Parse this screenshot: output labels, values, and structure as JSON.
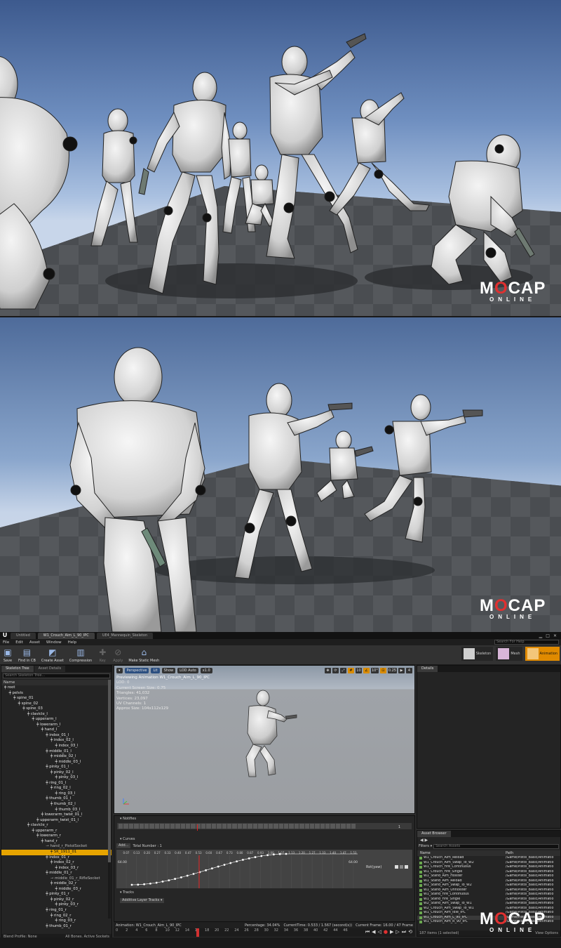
{
  "branding": {
    "mocap_big_pre": "M",
    "mocap_big_o": "O",
    "mocap_big_post": "CAP",
    "mocap_small": "ONLINE"
  },
  "editor": {
    "doc_tabs": [
      "Untitled",
      "W1_Crouch_Aim_L_90_IPC",
      "UE4_Mannequin_Skeleton"
    ],
    "menu": [
      "File",
      "Edit",
      "Asset",
      "Window",
      "Help"
    ],
    "help_search_placeholder": "Search For Help",
    "toolbar": [
      {
        "label": "Save",
        "icon": "save-icon"
      },
      {
        "label": "Find in CB",
        "icon": "find-in-content-browser-icon"
      },
      {
        "label": "Create Asset",
        "icon": "create-asset-icon"
      },
      {
        "label": "Compression",
        "icon": "compression-icon"
      },
      {
        "label": "Key",
        "icon": "key-icon",
        "disabled": true
      },
      {
        "label": "Apply",
        "icon": "apply-icon",
        "disabled": true
      },
      {
        "label": "Make Static Mesh",
        "icon": "make-static-mesh-icon"
      }
    ],
    "modes": [
      {
        "label": "Skeleton"
      },
      {
        "label": "Mesh"
      },
      {
        "label": "Animation",
        "active": true
      }
    ],
    "left_tabs": [
      "Skeleton Tree",
      "Asset Details"
    ],
    "skeleton_search_placeholder": "Search Skeleton Tree...",
    "tree_header": "Name",
    "bones": [
      {
        "name": "root",
        "depth": 0
      },
      {
        "name": "pelvis",
        "depth": 1
      },
      {
        "name": "spine_01",
        "depth": 2
      },
      {
        "name": "spine_02",
        "depth": 3
      },
      {
        "name": "spine_03",
        "depth": 4
      },
      {
        "name": "clavicle_l",
        "depth": 5
      },
      {
        "name": "upperarm_l",
        "depth": 6
      },
      {
        "name": "lowerarm_l",
        "depth": 7
      },
      {
        "name": "hand_l",
        "depth": 8
      },
      {
        "name": "index_01_l",
        "depth": 9
      },
      {
        "name": "index_02_l",
        "depth": 10
      },
      {
        "name": "index_03_l",
        "depth": 11
      },
      {
        "name": "middle_01_l",
        "depth": 9
      },
      {
        "name": "middle_02_l",
        "depth": 10
      },
      {
        "name": "middle_03_l",
        "depth": 11
      },
      {
        "name": "pinky_01_l",
        "depth": 9
      },
      {
        "name": "pinky_02_l",
        "depth": 10
      },
      {
        "name": "pinky_03_l",
        "depth": 11
      },
      {
        "name": "ring_01_l",
        "depth": 9
      },
      {
        "name": "ring_02_l",
        "depth": 10
      },
      {
        "name": "ring_03_l",
        "depth": 11
      },
      {
        "name": "thumb_01_l",
        "depth": 9
      },
      {
        "name": "thumb_02_l",
        "depth": 10
      },
      {
        "name": "thumb_03_l",
        "depth": 11
      },
      {
        "name": "lowerarm_twist_01_l",
        "depth": 8
      },
      {
        "name": "upperarm_twist_01_l",
        "depth": 7
      },
      {
        "name": "clavicle_r",
        "depth": 5
      },
      {
        "name": "upperarm_r",
        "depth": 6
      },
      {
        "name": "lowerarm_r",
        "depth": 7
      },
      {
        "name": "hand_r",
        "depth": 8
      },
      {
        "name": "hand_r_PistolSocket",
        "depth": 9,
        "socket": true
      },
      {
        "name": "SK_1911_01",
        "depth": 10,
        "selected": true
      },
      {
        "name": "index_01_r",
        "depth": 9
      },
      {
        "name": "index_02_r",
        "depth": 10
      },
      {
        "name": "index_03_r",
        "depth": 11
      },
      {
        "name": "middle_01_r",
        "depth": 9
      },
      {
        "name": "middle_01_r_RifleSocket",
        "depth": 10,
        "socket": true
      },
      {
        "name": "middle_02_r",
        "depth": 10
      },
      {
        "name": "middle_03_r",
        "depth": 11
      },
      {
        "name": "pinky_01_r",
        "depth": 9
      },
      {
        "name": "pinky_02_r",
        "depth": 10
      },
      {
        "name": "pinky_03_r",
        "depth": 11
      },
      {
        "name": "ring_01_r",
        "depth": 9
      },
      {
        "name": "ring_02_r",
        "depth": 10
      },
      {
        "name": "ring_03_r",
        "depth": 11
      },
      {
        "name": "thumb_01_r",
        "depth": 9
      }
    ],
    "skeleton_footer_left": "Blend Profile: None",
    "skeleton_footer_right": "All Bones, Active Sockets",
    "viewport": {
      "buttons": [
        "Perspective",
        "Lit",
        "Show",
        "LOD Auto",
        "x1.0"
      ],
      "right_values": [
        "10",
        "10°",
        "0.25",
        "4"
      ],
      "info": {
        "title": "Previewing Animation W1_Crouch_Aim_L_90_IPC",
        "lod": "LOD: 0",
        "screen_size": "Current Screen Size: 0.75",
        "triangles": "Triangles: 41,032",
        "vertices": "Vertices: 23,097",
        "uv": "UV Channels: 1",
        "approx": "Approx Size: 104x112x129"
      }
    },
    "notifies": {
      "header": "Notifies",
      "track_value": "1"
    },
    "curves": {
      "header": "Curves",
      "add": "Add...",
      "total": "Total Number : 1",
      "curve_name": "Rot(yaw)",
      "y_top": "64.00",
      "y_bottom": "0.00",
      "y_right": "64.00",
      "x_labels": [
        "0.07",
        "0.13",
        "0.20",
        "0.27",
        "0.33",
        "0.40",
        "0.47",
        "0.53",
        "0.60",
        "0.67",
        "0.73",
        "0.80",
        "0.87",
        "0.93",
        "1.00",
        "1.07",
        "1.13",
        "1.20",
        "1.27",
        "1.33",
        "1.40",
        "1.47",
        "1.53"
      ]
    },
    "tracks": {
      "header": "Tracks",
      "additive": "Additive Layer Tracks"
    },
    "anim_bar": {
      "animation": "Animation: W1_Crouch_Aim_L_90_IPC",
      "percentage": "Percentage: 34.04%",
      "current_time": "CurrentTime: 0.533 / 1.567 (second(s))",
      "current_frame": "Current Frame: 16.00 / 47 Frame"
    },
    "timeline_numbers": [
      "0",
      "2",
      "4",
      "6",
      "8",
      "10",
      "12",
      "14",
      "16",
      "18",
      "20",
      "22",
      "24",
      "26",
      "28",
      "30",
      "32",
      "34",
      "36",
      "38",
      "40",
      "42",
      "44",
      "46"
    ],
    "details_tab": "Details",
    "asset_browser": {
      "tab": "Asset Browser",
      "filters": "Filters",
      "search_placeholder": "Search Assets",
      "col_name": "Name",
      "col_path": "Path",
      "rows": [
        {
          "name": "W1_Crouch_Aim_Reload",
          "path": "/Game/Pistol_Basic/Animatio"
        },
        {
          "name": "W1_Crouch_Aim_Swap_To_W2",
          "path": "/Game/Pistol_Basic/Animatio"
        },
        {
          "name": "W1_Crouch_Fire_Continuous",
          "path": "/Game/Pistol_Basic/Animatio"
        },
        {
          "name": "W1_Crouch_Fire_Single",
          "path": "/Game/Pistol_Basic/Animatio"
        },
        {
          "name": "W1_Stand_Aim_Holster",
          "path": "/Game/Pistol_Basic/Animatio"
        },
        {
          "name": "W1_Stand_Aim_Reload",
          "path": "/Game/Pistol_Basic/Animatio"
        },
        {
          "name": "W1_Stand_Aim_Swap_To_W2",
          "path": "/Game/Pistol_Basic/Animatio"
        },
        {
          "name": "W1_Stand_Aim_Unholster",
          "path": "/Game/Pistol_Basic/Animatio"
        },
        {
          "name": "W1_Stand_Fire_Continuous",
          "path": "/Game/Pistol_Basic/Animatio"
        },
        {
          "name": "W1_Stand_Fire_Single",
          "path": "/Game/Pistol_Basic/Animatio"
        },
        {
          "name": "W2_Stand_Aim_Swap_To_W1",
          "path": "/Game/Pistol_Basic/Animatio"
        },
        {
          "name": "W2_Crouch_Aim_Swap_To_W1",
          "path": "/Game/Pistol_Basic/Animatio"
        },
        {
          "name": "W1_Crouch_Aim_Idle_IPC",
          "path": "/Game/Pistol_Basic/Animatio"
        },
        {
          "name": "W1_Crouch_Aim_L_90_IPC",
          "path": "/Game/Pistol_Basic/Animatio",
          "selected": true
        },
        {
          "name": "W1_Crouch_Aim_R_90_IPC",
          "path": "/Game/Pistol_Basic/Animatio"
        }
      ],
      "footer_left": "187 items (1 selected)",
      "footer_right": "View Options"
    }
  }
}
